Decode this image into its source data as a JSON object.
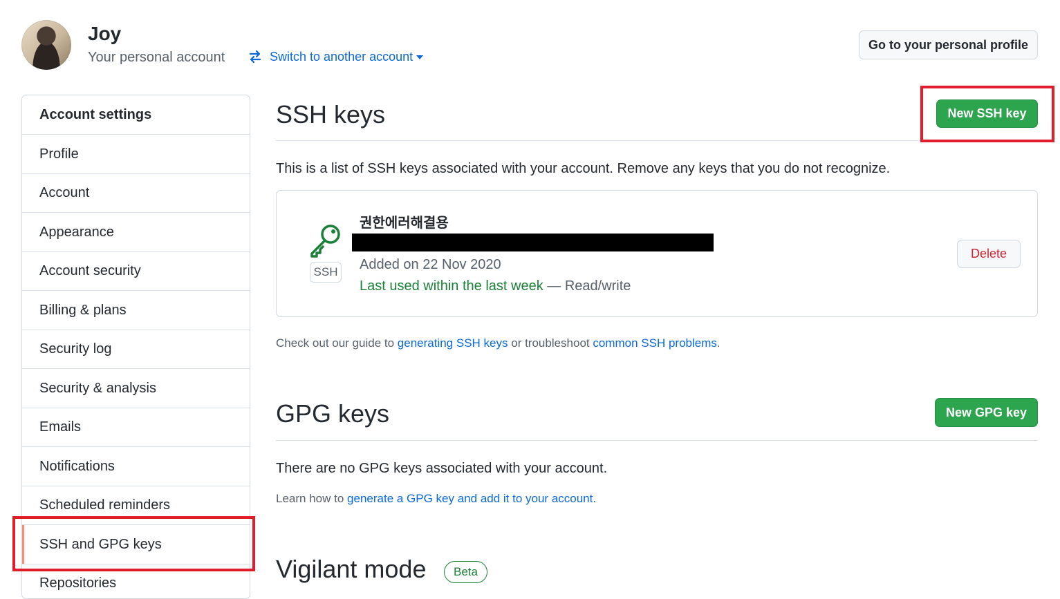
{
  "header": {
    "user_name": "Joy",
    "account_type": "Your personal account",
    "switch_label": "Switch to another account",
    "profile_button": "Go to your personal profile"
  },
  "sidebar": {
    "heading": "Account settings",
    "items": [
      {
        "label": "Profile"
      },
      {
        "label": "Account"
      },
      {
        "label": "Appearance"
      },
      {
        "label": "Account security"
      },
      {
        "label": "Billing & plans"
      },
      {
        "label": "Security log"
      },
      {
        "label": "Security & analysis"
      },
      {
        "label": "Emails"
      },
      {
        "label": "Notifications"
      },
      {
        "label": "Scheduled reminders"
      },
      {
        "label": "SSH and GPG keys"
      },
      {
        "label": "Repositories"
      }
    ],
    "selected": "SSH and GPG keys"
  },
  "ssh": {
    "title": "SSH keys",
    "new_button": "New SSH key",
    "description": "This is a list of SSH keys associated with your account. Remove any keys that you do not recognize.",
    "key": {
      "type_label": "SSH",
      "name": "권한에러해결용",
      "added": "Added on 22 Nov 2020",
      "last_used": "Last used within the last week",
      "access": "— Read/write",
      "delete_button": "Delete"
    },
    "guide_prefix": "Check out our guide to",
    "guide_link1": "generating SSH keys",
    "guide_middle": "or troubleshoot",
    "guide_link2": "common SSH problems",
    "guide_suffix": "."
  },
  "gpg": {
    "title": "GPG keys",
    "new_button": "New GPG key",
    "empty_text": "There are no GPG keys associated with your account.",
    "learn_prefix": "Learn how to",
    "learn_link": "generate a GPG key and add it to your account",
    "learn_suffix": "."
  },
  "vigilant": {
    "title": "Vigilant mode",
    "badge": "Beta"
  },
  "colors": {
    "primary_green": "#2da44e",
    "link_blue": "#0969da",
    "danger_red": "#cf222e",
    "highlight_red": "#e11d2b",
    "selected_marker": "#fd8c73"
  },
  "icons": {
    "switch": "arrow-switch-icon",
    "caret": "caret-down-icon",
    "key": "key-icon"
  }
}
